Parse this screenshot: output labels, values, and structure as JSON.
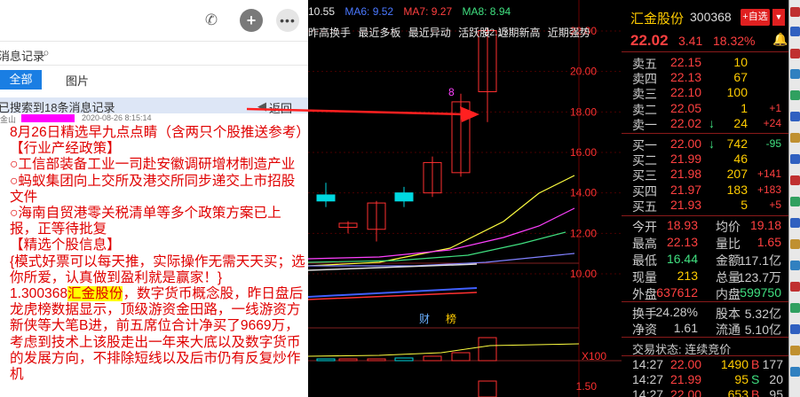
{
  "chat": {
    "title": "消息记录",
    "tabs": {
      "all": "全部",
      "images": "图片"
    },
    "search_result": "已搜索到18条消息记录",
    "back": "返回",
    "sender": "金山",
    "time": "2020-08-26 8:15:14",
    "lines": [
      "8月26日精选早九点点睛（含两只个股推送参考）",
      "【行业产经政策】",
      "○工信部装备工业一司赴安徽调研增材制造产业",
      "○蚂蚁集团向上交所及港交所同步递交上市招股文件",
      "○海南自贸港零关税清单等多个政策方案已上报，正等待批复",
      "【精选个股信息】",
      "{模式好票可以每天推，实际操作无需天天买；选你所爱，认真做到盈利就是赢家！}"
    ],
    "stock_line_prefix": "1.300368",
    "stock_highlight": "汇金股份",
    "stock_line_rest": "，数字货币概念股，昨日盘后龙虎榜数据显示，顶级游资金田路，一线游资方新侠等大笔B进，前五席位合计净买了9669万，考虑到技术上该股走出一年来大底以及数字货币的发展方向，不排除短线以及后市仍有反复炒作机"
  },
  "chart": {
    "ma_labels": [
      {
        "text": "10.55",
        "color": "#e8e8e8"
      },
      {
        "text": "MA6: 9.52",
        "color": "#4a78ff"
      },
      {
        "text": "MA7: 9.27",
        "color": "#ff4040"
      },
      {
        "text": "MA8: 8.94",
        "color": "#40e080"
      }
    ],
    "filters": [
      "昨高换手",
      "最近多板",
      "最近异动",
      "活跃股",
      "近期新高",
      "近期强势"
    ],
    "caiwu": "财",
    "bang": "榜",
    "xlabel": "X100",
    "candle_label": "8",
    "label_2212": "22.13",
    "chart_data": {
      "type": "candlestick",
      "title": "",
      "y_ticks": [
        22.0,
        20.0,
        18.0,
        16.0,
        14.0,
        12.0,
        10.0
      ],
      "volume_tick": 1.5,
      "candles": [
        {
          "o": 13.9,
          "h": 14.5,
          "l": 13.3,
          "c": 13.6,
          "up": false
        },
        {
          "o": 12.3,
          "h": 12.6,
          "l": 12.0,
          "c": 12.5,
          "up": true
        },
        {
          "o": 12.2,
          "h": 13.6,
          "l": 11.6,
          "c": 13.5,
          "up": true
        },
        {
          "o": 13.6,
          "h": 14.3,
          "l": 13.3,
          "c": 14.0,
          "up": false
        },
        {
          "o": 14.0,
          "h": 15.8,
          "l": 13.8,
          "c": 15.5,
          "up": true
        },
        {
          "o": 15.0,
          "h": 18.9,
          "l": 14.8,
          "c": 18.5,
          "up": true
        },
        {
          "o": 19.0,
          "h": 22.13,
          "l": 17.5,
          "c": 22.02,
          "up": true
        }
      ]
    }
  },
  "quote": {
    "name": "汇金股份",
    "code": "300368",
    "add_button": "+自选",
    "price": "22.02",
    "change": "3.41",
    "pct": "18.32%",
    "asks": [
      {
        "label": "卖五",
        "price": "22.15",
        "vol": "10",
        "chg": ""
      },
      {
        "label": "卖四",
        "price": "22.13",
        "vol": "67",
        "chg": ""
      },
      {
        "label": "卖三",
        "price": "22.10",
        "vol": "100",
        "chg": ""
      },
      {
        "label": "卖二",
        "price": "22.05",
        "vol": "1",
        "chg": "+1"
      },
      {
        "label": "卖一",
        "price": "22.02",
        "vol": "24",
        "chg": "+24",
        "arrow": "↓"
      }
    ],
    "bids": [
      {
        "label": "买一",
        "price": "22.00",
        "vol": "742",
        "chg": "-95",
        "arrow": "↓"
      },
      {
        "label": "买二",
        "price": "21.99",
        "vol": "46",
        "chg": ""
      },
      {
        "label": "买三",
        "price": "21.98",
        "vol": "207",
        "chg": "+141"
      },
      {
        "label": "买四",
        "price": "21.97",
        "vol": "183",
        "chg": "+183"
      },
      {
        "label": "买五",
        "price": "21.93",
        "vol": "5",
        "chg": "+5"
      }
    ],
    "stats": [
      {
        "l": "今开",
        "v": "18.93",
        "c": "#ff4040",
        "l2": "均价",
        "v2": "19.18",
        "c2": "#ff4040"
      },
      {
        "l": "最高",
        "v": "22.13",
        "c": "#ff4040",
        "l2": "量比",
        "v2": "1.65",
        "c2": "#ff4040"
      },
      {
        "l": "最低",
        "v": "16.44",
        "c": "#40e080",
        "l2": "金额",
        "v2": "117.1亿",
        "c2": "#ccc"
      },
      {
        "l": "现量",
        "v": "213",
        "c": "#ffcc00",
        "l2": "总量",
        "v2": "123.7万",
        "c2": "#ccc"
      },
      {
        "l": "外盘",
        "v": "637612",
        "c": "#ff4040",
        "l2": "内盘",
        "v2": "599750",
        "c2": "#40e080"
      }
    ],
    "stats2": [
      {
        "l": "换手",
        "v": "24.28%",
        "c": "#ccc",
        "l2": "股本",
        "v2": "5.32亿",
        "c2": "#ccc"
      },
      {
        "l": "净资",
        "v": "1.61",
        "c": "#ccc",
        "l2": "流通",
        "v2": "5.10亿",
        "c2": "#ccc"
      }
    ],
    "trade_status": "交易状态: 连续竞价",
    "ticks": [
      {
        "time": "14:27",
        "price": "22.00",
        "vol": "1490",
        "dir": "B",
        "cnt": "177"
      },
      {
        "time": "14:27",
        "price": "21.99",
        "vol": "95",
        "dir": "S",
        "cnt": "20"
      },
      {
        "time": "14:27",
        "price": "22.00",
        "vol": "653",
        "dir": "B",
        "cnt": "95"
      }
    ]
  },
  "colors": {
    "up": "#ff3030",
    "down": "#00d8e0",
    "accent": "#1a7ee3",
    "highlight": "#ffff00"
  }
}
